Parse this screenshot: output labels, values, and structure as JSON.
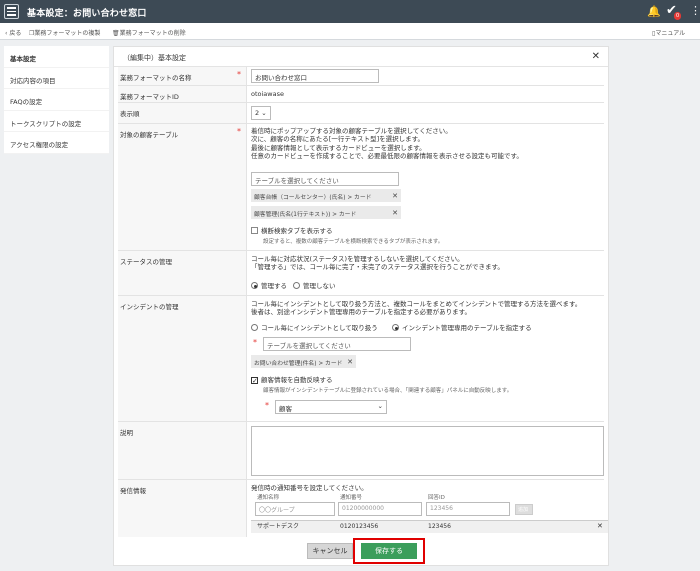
{
  "header": {
    "title": "基本設定：お問い合わせ窓口",
    "badge": "0"
  },
  "toolbar": {
    "back": "戻る",
    "copy": "業務フォーマットの複製",
    "delete": "業務フォーマットの削除",
    "manual": "マニュアル"
  },
  "sidebar": {
    "items": [
      {
        "label": "基本設定"
      },
      {
        "label": "対応内容の項目"
      },
      {
        "label": "FAQの設定"
      },
      {
        "label": "トークスクリプトの設定"
      },
      {
        "label": "アクセス権限の設定"
      }
    ]
  },
  "panel": {
    "title": "（編集中）基本設定"
  },
  "fields": {
    "name": {
      "label": "業務フォーマットの名称",
      "value": "お問い合わせ窓口"
    },
    "id": {
      "label": "業務フォーマットID",
      "value": "otoiawase"
    },
    "order": {
      "label": "表示順",
      "value": "2"
    },
    "customer": {
      "label": "対象の顧客テーブル",
      "desc": [
        "着信時にポップアップする対象の顧客テーブルを選択してください。",
        "次に、顧客の名称にあたる[一行テキスト型]を選択します。",
        "最後に顧客情報として表示するカードビューを選択します。",
        "任意のカードビューを作成することで、必要最低限の顧客情報を表示させる設定も可能です。"
      ],
      "placeholder": "テーブルを選択してください",
      "chips": [
        "顧客台帳（コールセンター）(氏名) > カード",
        "顧客管理(氏名(1行テキスト)) > カード"
      ],
      "checkbox": "横断検索タブを表示する",
      "note": "設定すると、複数の顧客テーブルを横断検索できるタブが表示されます。"
    },
    "status": {
      "label": "ステータスの管理",
      "desc": [
        "コール毎に対応状況(ステータス)を管理するしないを選択してください。",
        "「管理する」では、コール毎に完了・未完了のステータス選択を行うことができます。"
      ],
      "opt1": "管理する",
      "opt2": "管理しない"
    },
    "incident": {
      "label": "インシデントの管理",
      "desc": [
        "コール毎にインシデントとして取り扱う方法と、複数コールをまとめてインシデントで管理する方法を選べます。",
        "後者は、別途インシデント管理専用のテーブルを指定する必要があります。"
      ],
      "opt1": "コール毎にインシデントとして取り扱う",
      "opt2": "インシデント管理専用のテーブルを指定する",
      "placeholder": "テーブルを選択してください",
      "chip": "お問い合わせ管理(件名) > カード",
      "checkbox": "顧客情報を自動反映する",
      "note": "顧客情報がインシデントテーブルに登録されている場合、「関連する顧客」パネルに自動反映します。",
      "select": "顧客"
    },
    "desc": {
      "label": "説明"
    },
    "notify": {
      "label": "発信情報",
      "desc": "発信時の通知番号を設定してください。",
      "cols": [
        "通知名称",
        "通知番号",
        "回答ID"
      ],
      "placeholders": [
        "〇〇グループ",
        "01200000000",
        "123456"
      ],
      "add": "追加",
      "row": [
        "サポートデスク",
        "0120123456",
        "123456"
      ]
    }
  },
  "buttons": {
    "cancel": "キャンセル",
    "save": "保存する"
  }
}
